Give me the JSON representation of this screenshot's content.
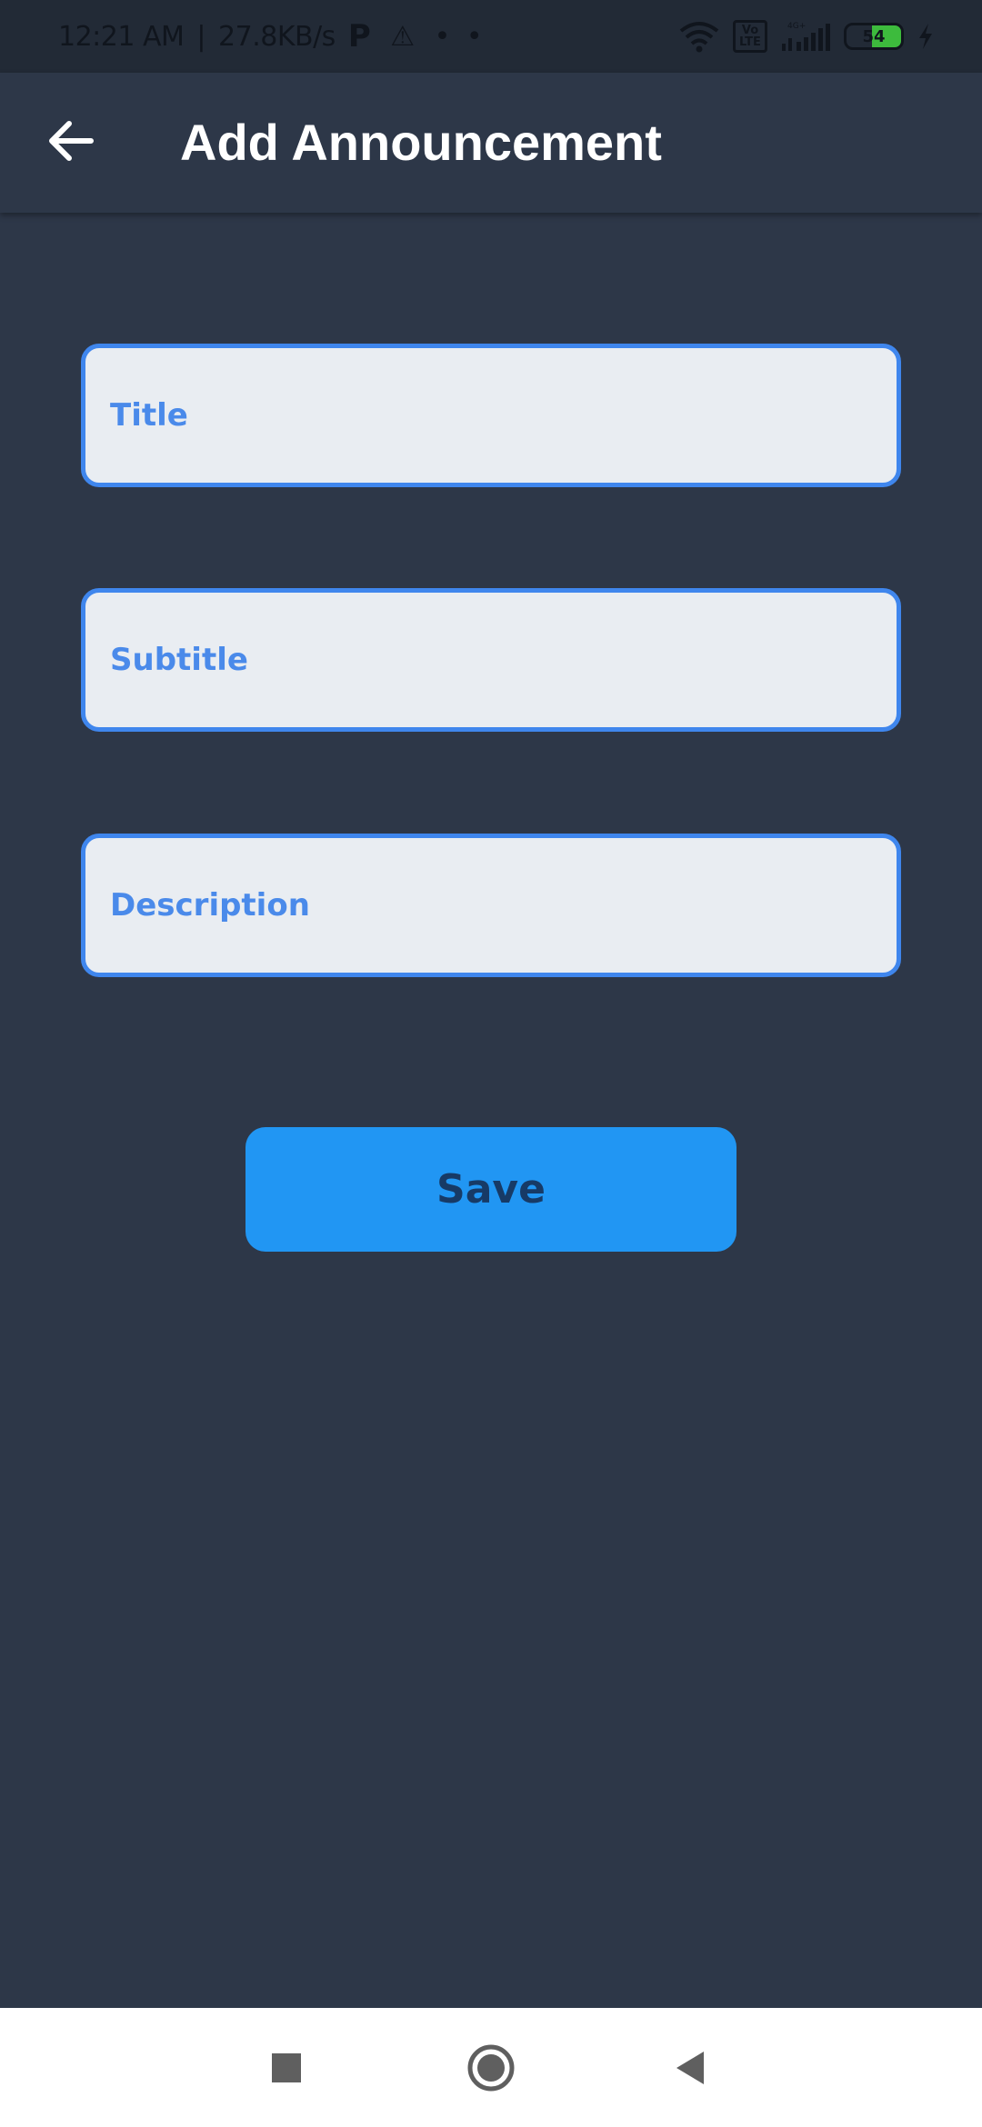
{
  "status_bar": {
    "time": "12:21 AM",
    "separator": "|",
    "network_speed": "27.8KB/s",
    "p_icon": "P",
    "warning_icon": "⚠",
    "dots": "• •",
    "volte_label": "Vo LTE",
    "battery_level": "54",
    "battery_fraction": 0.54,
    "icons": [
      "wifi-icon",
      "volte-icon",
      "signal-icon",
      "battery-icon",
      "charging-icon"
    ]
  },
  "header": {
    "title": "Add Announcement",
    "back_icon": "arrow-left-icon"
  },
  "form": {
    "title_placeholder": "Title",
    "subtitle_placeholder": "Subtitle",
    "description_placeholder": "Description",
    "save_label": "Save"
  },
  "nav_bar": {
    "icons": [
      "recents-square-icon",
      "home-circle-icon",
      "back-triangle-icon"
    ]
  },
  "colors": {
    "background": "#2d3748",
    "status_bar": "#222a36",
    "field_background": "#e9edf2",
    "field_border": "#3f86ed",
    "placeholder": "#4a8aea",
    "button": "#2196f3",
    "button_text": "#173a66",
    "title_text": "#ffffff",
    "nav_bar": "#ffffff"
  }
}
